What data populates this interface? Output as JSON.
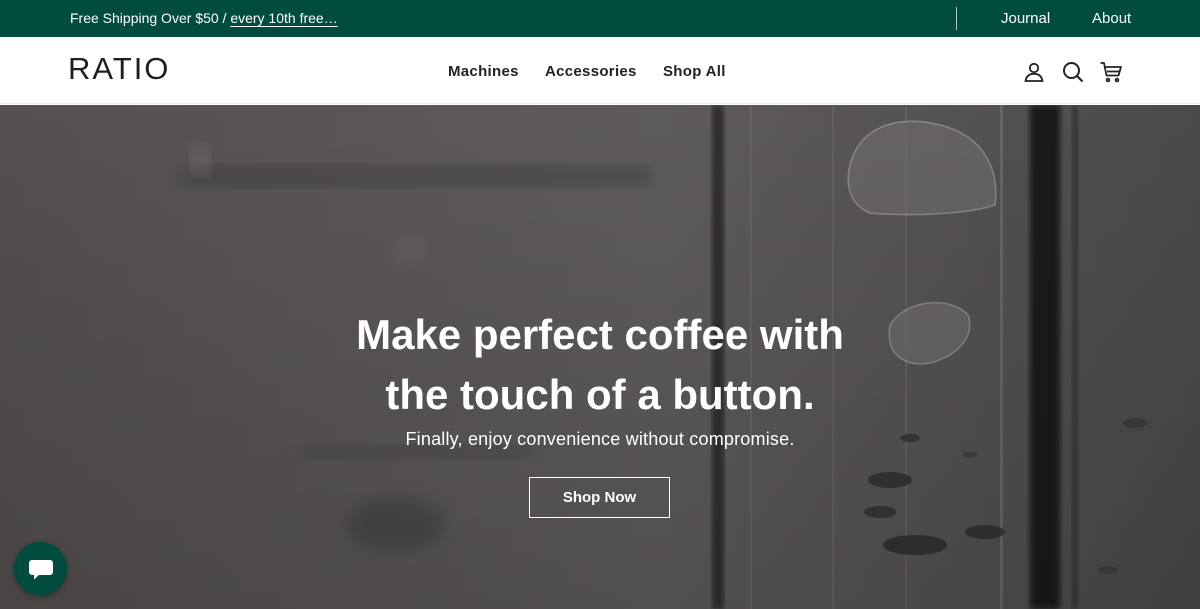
{
  "announcement": {
    "promo_text": "Free Shipping Over $50 / ",
    "promo_link": "every 10th free…",
    "links": {
      "journal": "Journal",
      "about": "About"
    }
  },
  "header": {
    "logo": "RATIO",
    "nav": {
      "machines": "Machines",
      "accessories": "Accessories",
      "shop_all": "Shop All"
    },
    "icons": [
      "account-icon",
      "search-icon",
      "cart-icon"
    ]
  },
  "hero": {
    "title_line1": "Make perfect coffee with",
    "title_line2": "the touch of a button.",
    "subtitle": "Finally, enjoy convenience without compromise.",
    "cta": "Shop Now"
  },
  "chat": {
    "icon": "chat-icon"
  },
  "colors": {
    "brand_green": "#004d40",
    "text_dark": "#222222",
    "hero_overlay": "#5e5a59"
  }
}
